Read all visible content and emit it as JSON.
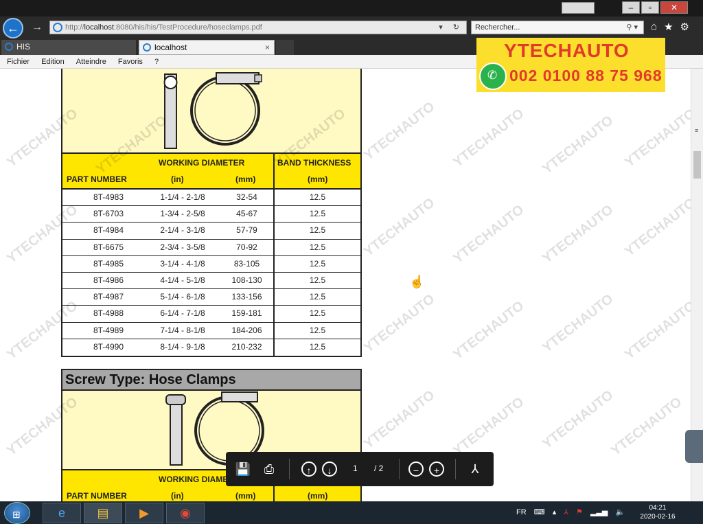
{
  "browser": {
    "url_base": "http://",
    "url_host": "localhost",
    "url_path": ":8080/his/his/TestProcedure/hoseclamps.pdf",
    "search_placeholder": "Rechercher...",
    "tabs": [
      {
        "label": "HIS"
      },
      {
        "label": "localhost",
        "close": "×"
      }
    ],
    "menu": [
      "Fichier",
      "Edition",
      "Atteindre",
      "Favoris",
      "?"
    ]
  },
  "table1": {
    "header": {
      "working_diameter": "WORKING DIAMETER",
      "band_thickness": "BAND THICKNESS",
      "part_number": "PART NUMBER",
      "unit_in": "(in)",
      "unit_mm": "(mm)",
      "unit_mm2": "(mm)"
    },
    "rows": [
      {
        "part": "8T-4983",
        "inch": "1-1/4 - 2-1/8",
        "mm": "32-54",
        "thick": "12.5"
      },
      {
        "part": "8T-6703",
        "inch": "1-3/4 - 2-5/8",
        "mm": "45-67",
        "thick": "12.5"
      },
      {
        "part": "8T-4984",
        "inch": "2-1/4 - 3-1/8",
        "mm": "57-79",
        "thick": "12.5"
      },
      {
        "part": "8T-6675",
        "inch": "2-3/4 - 3-5/8",
        "mm": "70-92",
        "thick": "12.5"
      },
      {
        "part": "8T-4985",
        "inch": "3-1/4 - 4-1/8",
        "mm": "83-105",
        "thick": "12.5"
      },
      {
        "part": "8T-4986",
        "inch": "4-1/4 - 5-1/8",
        "mm": "108-130",
        "thick": "12.5"
      },
      {
        "part": "8T-4987",
        "inch": "5-1/4 - 6-1/8",
        "mm": "133-156",
        "thick": "12.5"
      },
      {
        "part": "8T-4988",
        "inch": "6-1/4 - 7-1/8",
        "mm": "159-181",
        "thick": "12.5"
      },
      {
        "part": "8T-4989",
        "inch": "7-1/4 - 8-1/8",
        "mm": "184-206",
        "thick": "12.5"
      },
      {
        "part": "8T-4990",
        "inch": "8-1/4 - 9-1/8",
        "mm": "210-232",
        "thick": "12.5"
      }
    ]
  },
  "section2": {
    "title": "Screw Type:  Hose Clamps",
    "header": {
      "working_diameter": "WORKING DIAME",
      "part_number": "PART NUMBER",
      "unit_in": "(in)",
      "unit_mm": "(mm)",
      "unit_mm2": "(mm)"
    }
  },
  "pdf_toolbar": {
    "page_current": "1",
    "page_total": "/ 2"
  },
  "watermark": {
    "brand": "YTECHAUTO",
    "phone": "002 0100 88 75 968"
  },
  "taskbar": {
    "lang": "FR",
    "time": "04:21",
    "date": "2020-02-16"
  },
  "colors": {
    "header_yellow": "#ffe600",
    "image_bg": "#fff9c4",
    "brand_red": "#e23a2a",
    "ad_yellow": "#fcde2c"
  }
}
